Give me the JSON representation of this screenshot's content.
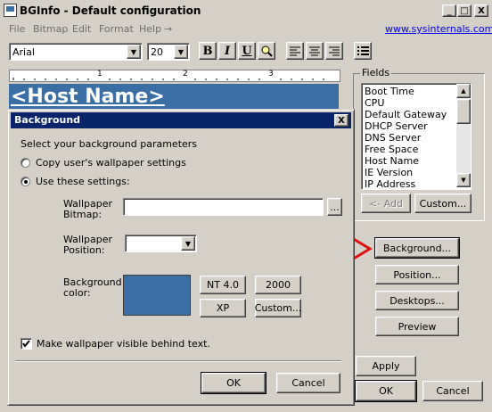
{
  "window": {
    "title": "BGInfo - Default configuration",
    "minimize": "_",
    "maximize": "□",
    "close": "X"
  },
  "menu": {
    "items": [
      "File",
      "Bitmap",
      "Edit",
      "Format",
      "Help"
    ],
    "help_arrow": "→",
    "link": "www.sysinternals.com"
  },
  "toolbar": {
    "font": "Arial",
    "size": "20",
    "bold": "B",
    "italic": "I",
    "underline": "U"
  },
  "ruler": {
    "marks": [
      "1",
      "2",
      "3"
    ]
  },
  "editor": {
    "host_name": "<Host Name>"
  },
  "fields": {
    "label": "Fields",
    "items": [
      "Boot Time",
      "CPU",
      "Default Gateway",
      "DHCP Server",
      "DNS Server",
      "Free Space",
      "Host Name",
      "IE Version",
      "IP Address"
    ],
    "add": "<- Add",
    "custom": "Custom..."
  },
  "side_buttons": {
    "background": "Background...",
    "position": "Position...",
    "desktops": "Desktops...",
    "preview": "Preview",
    "apply": "Apply",
    "ok": "OK",
    "cancel": "Cancel"
  },
  "dialog": {
    "title": "Background",
    "close": "X",
    "prompt": "Select your background parameters",
    "radio_copy": "Copy user's wallpaper settings",
    "radio_use": "Use these settings:",
    "wallpaper_bitmap_label_1": "Wallpaper",
    "wallpaper_bitmap_label_2": "Bitmap:",
    "wallpaper_bitmap_value": "",
    "browse": "...",
    "wallpaper_position_label_1": "Wallpaper",
    "wallpaper_position_label_2": "Position:",
    "wallpaper_position_value": "",
    "bg_color_label_1": "Background",
    "bg_color_label_2": "color:",
    "bg_color": "#3a6ea5",
    "btn_nt4": "NT 4.0",
    "btn_2000": "2000",
    "btn_xp": "XP",
    "btn_custom": "Custom...",
    "checkbox": "Make wallpaper visible behind text.",
    "ok": "OK",
    "cancel": "Cancel"
  },
  "colors": {
    "face": "#d4d0c8",
    "active_title": "#0a246a",
    "highlight_band": "#3a6ea5",
    "arrow": "#e01010"
  }
}
